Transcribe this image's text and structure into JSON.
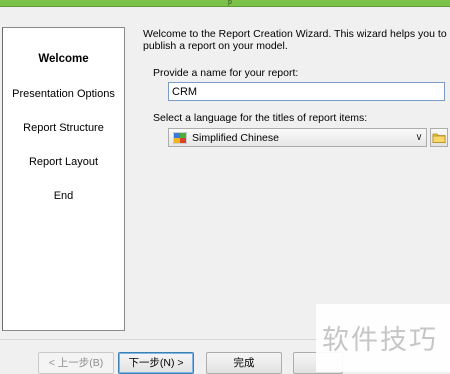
{
  "titlebar": {
    "glyph": "p"
  },
  "nav": {
    "items": [
      {
        "label": "Welcome",
        "active": true
      },
      {
        "label": "Presentation Options",
        "active": false
      },
      {
        "label": "Report Structure",
        "active": false
      },
      {
        "label": "Report Layout",
        "active": false
      },
      {
        "label": "End",
        "active": false
      }
    ]
  },
  "main": {
    "intro": "Welcome to the Report Creation Wizard. This wizard helps you to publish a report on your model.",
    "name_label": "Provide a name for your report:",
    "name_value": "CRM",
    "language_label": "Select a language for the titles of report items:",
    "language_value": "Simplified Chinese",
    "language_icon": "language-flag-icon",
    "browse_icon": "folder-icon"
  },
  "buttons": {
    "back": "< 上一步(B)",
    "next": "下一步(N) >",
    "finish": "完成"
  },
  "watermark": "软件技巧",
  "colors": {
    "titlebar": "#7bc24b",
    "input_border": "#7a9cc6",
    "default_button": "#3c7fb1"
  }
}
